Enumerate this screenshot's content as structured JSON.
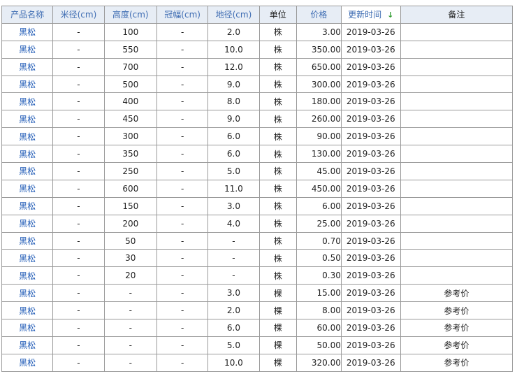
{
  "table": {
    "columns": [
      {
        "key": "name",
        "label": "产品名称"
      },
      {
        "key": "rice_diameter",
        "label": "米径(cm)"
      },
      {
        "key": "height",
        "label": "高度(cm)"
      },
      {
        "key": "crown",
        "label": "冠幅(cm)"
      },
      {
        "key": "ground_diameter",
        "label": "地径(cm)"
      },
      {
        "key": "unit",
        "label": "单位"
      },
      {
        "key": "price",
        "label": "价格"
      },
      {
        "key": "updated",
        "label": "更新时间",
        "sort_indicator": "↓",
        "sort_color": "#2e9a2e"
      },
      {
        "key": "note",
        "label": "备注"
      }
    ],
    "rows": [
      {
        "name": "黑松",
        "rice_diameter": "-",
        "height": "100",
        "crown": "-",
        "ground_diameter": "2.0",
        "unit": "株",
        "price": "3.00",
        "updated": "2019-03-26",
        "note": ""
      },
      {
        "name": "黑松",
        "rice_diameter": "-",
        "height": "550",
        "crown": "-",
        "ground_diameter": "10.0",
        "unit": "株",
        "price": "350.00",
        "updated": "2019-03-26",
        "note": ""
      },
      {
        "name": "黑松",
        "rice_diameter": "-",
        "height": "700",
        "crown": "-",
        "ground_diameter": "12.0",
        "unit": "株",
        "price": "650.00",
        "updated": "2019-03-26",
        "note": ""
      },
      {
        "name": "黑松",
        "rice_diameter": "-",
        "height": "500",
        "crown": "-",
        "ground_diameter": "9.0",
        "unit": "株",
        "price": "300.00",
        "updated": "2019-03-26",
        "note": ""
      },
      {
        "name": "黑松",
        "rice_diameter": "-",
        "height": "400",
        "crown": "-",
        "ground_diameter": "8.0",
        "unit": "株",
        "price": "180.00",
        "updated": "2019-03-26",
        "note": ""
      },
      {
        "name": "黑松",
        "rice_diameter": "-",
        "height": "450",
        "crown": "-",
        "ground_diameter": "9.0",
        "unit": "株",
        "price": "260.00",
        "updated": "2019-03-26",
        "note": ""
      },
      {
        "name": "黑松",
        "rice_diameter": "-",
        "height": "300",
        "crown": "-",
        "ground_diameter": "6.0",
        "unit": "株",
        "price": "90.00",
        "updated": "2019-03-26",
        "note": ""
      },
      {
        "name": "黑松",
        "rice_diameter": "-",
        "height": "350",
        "crown": "-",
        "ground_diameter": "6.0",
        "unit": "株",
        "price": "130.00",
        "updated": "2019-03-26",
        "note": ""
      },
      {
        "name": "黑松",
        "rice_diameter": "-",
        "height": "250",
        "crown": "-",
        "ground_diameter": "5.0",
        "unit": "株",
        "price": "45.00",
        "updated": "2019-03-26",
        "note": ""
      },
      {
        "name": "黑松",
        "rice_diameter": "-",
        "height": "600",
        "crown": "-",
        "ground_diameter": "11.0",
        "unit": "株",
        "price": "450.00",
        "updated": "2019-03-26",
        "note": ""
      },
      {
        "name": "黑松",
        "rice_diameter": "-",
        "height": "150",
        "crown": "-",
        "ground_diameter": "3.0",
        "unit": "株",
        "price": "6.00",
        "updated": "2019-03-26",
        "note": ""
      },
      {
        "name": "黑松",
        "rice_diameter": "-",
        "height": "200",
        "crown": "-",
        "ground_diameter": "4.0",
        "unit": "株",
        "price": "25.00",
        "updated": "2019-03-26",
        "note": ""
      },
      {
        "name": "黑松",
        "rice_diameter": "-",
        "height": "50",
        "crown": "-",
        "ground_diameter": "-",
        "unit": "株",
        "price": "0.70",
        "updated": "2019-03-26",
        "note": ""
      },
      {
        "name": "黑松",
        "rice_diameter": "-",
        "height": "30",
        "crown": "-",
        "ground_diameter": "-",
        "unit": "株",
        "price": "0.50",
        "updated": "2019-03-26",
        "note": ""
      },
      {
        "name": "黑松",
        "rice_diameter": "-",
        "height": "20",
        "crown": "-",
        "ground_diameter": "-",
        "unit": "株",
        "price": "0.30",
        "updated": "2019-03-26",
        "note": ""
      },
      {
        "name": "黑松",
        "rice_diameter": "-",
        "height": "-",
        "crown": "-",
        "ground_diameter": "3.0",
        "unit": "棵",
        "price": "15.00",
        "updated": "2019-03-26",
        "note": "参考价"
      },
      {
        "name": "黑松",
        "rice_diameter": "-",
        "height": "-",
        "crown": "-",
        "ground_diameter": "2.0",
        "unit": "棵",
        "price": "8.00",
        "updated": "2019-03-26",
        "note": "参考价"
      },
      {
        "name": "黑松",
        "rice_diameter": "-",
        "height": "-",
        "crown": "-",
        "ground_diameter": "6.0",
        "unit": "棵",
        "price": "60.00",
        "updated": "2019-03-26",
        "note": "参考价"
      },
      {
        "name": "黑松",
        "rice_diameter": "-",
        "height": "-",
        "crown": "-",
        "ground_diameter": "5.0",
        "unit": "棵",
        "price": "50.00",
        "updated": "2019-03-26",
        "note": "参考价"
      },
      {
        "name": "黑松",
        "rice_diameter": "-",
        "height": "-",
        "crown": "-",
        "ground_diameter": "10.0",
        "unit": "棵",
        "price": "320.00",
        "updated": "2019-03-26",
        "note": "参考价"
      }
    ]
  }
}
